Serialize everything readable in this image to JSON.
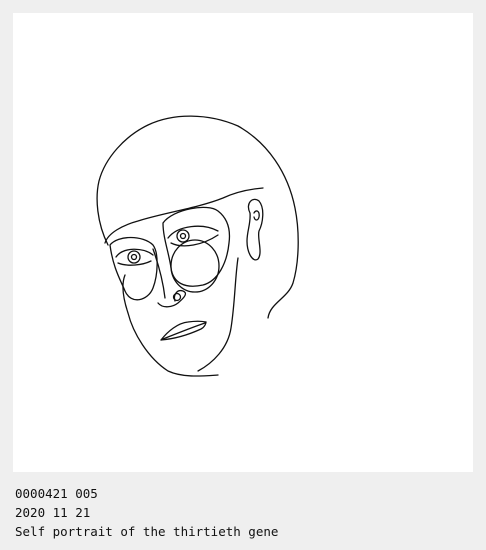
{
  "artwork": {
    "subject": "line-drawing-face",
    "stroke_color": "#111111",
    "background_color": "#ffffff"
  },
  "caption": {
    "id_line": "0000421 005",
    "date_line": "2020 11 21",
    "title_line": "Self portrait of the thirtieth gene"
  }
}
